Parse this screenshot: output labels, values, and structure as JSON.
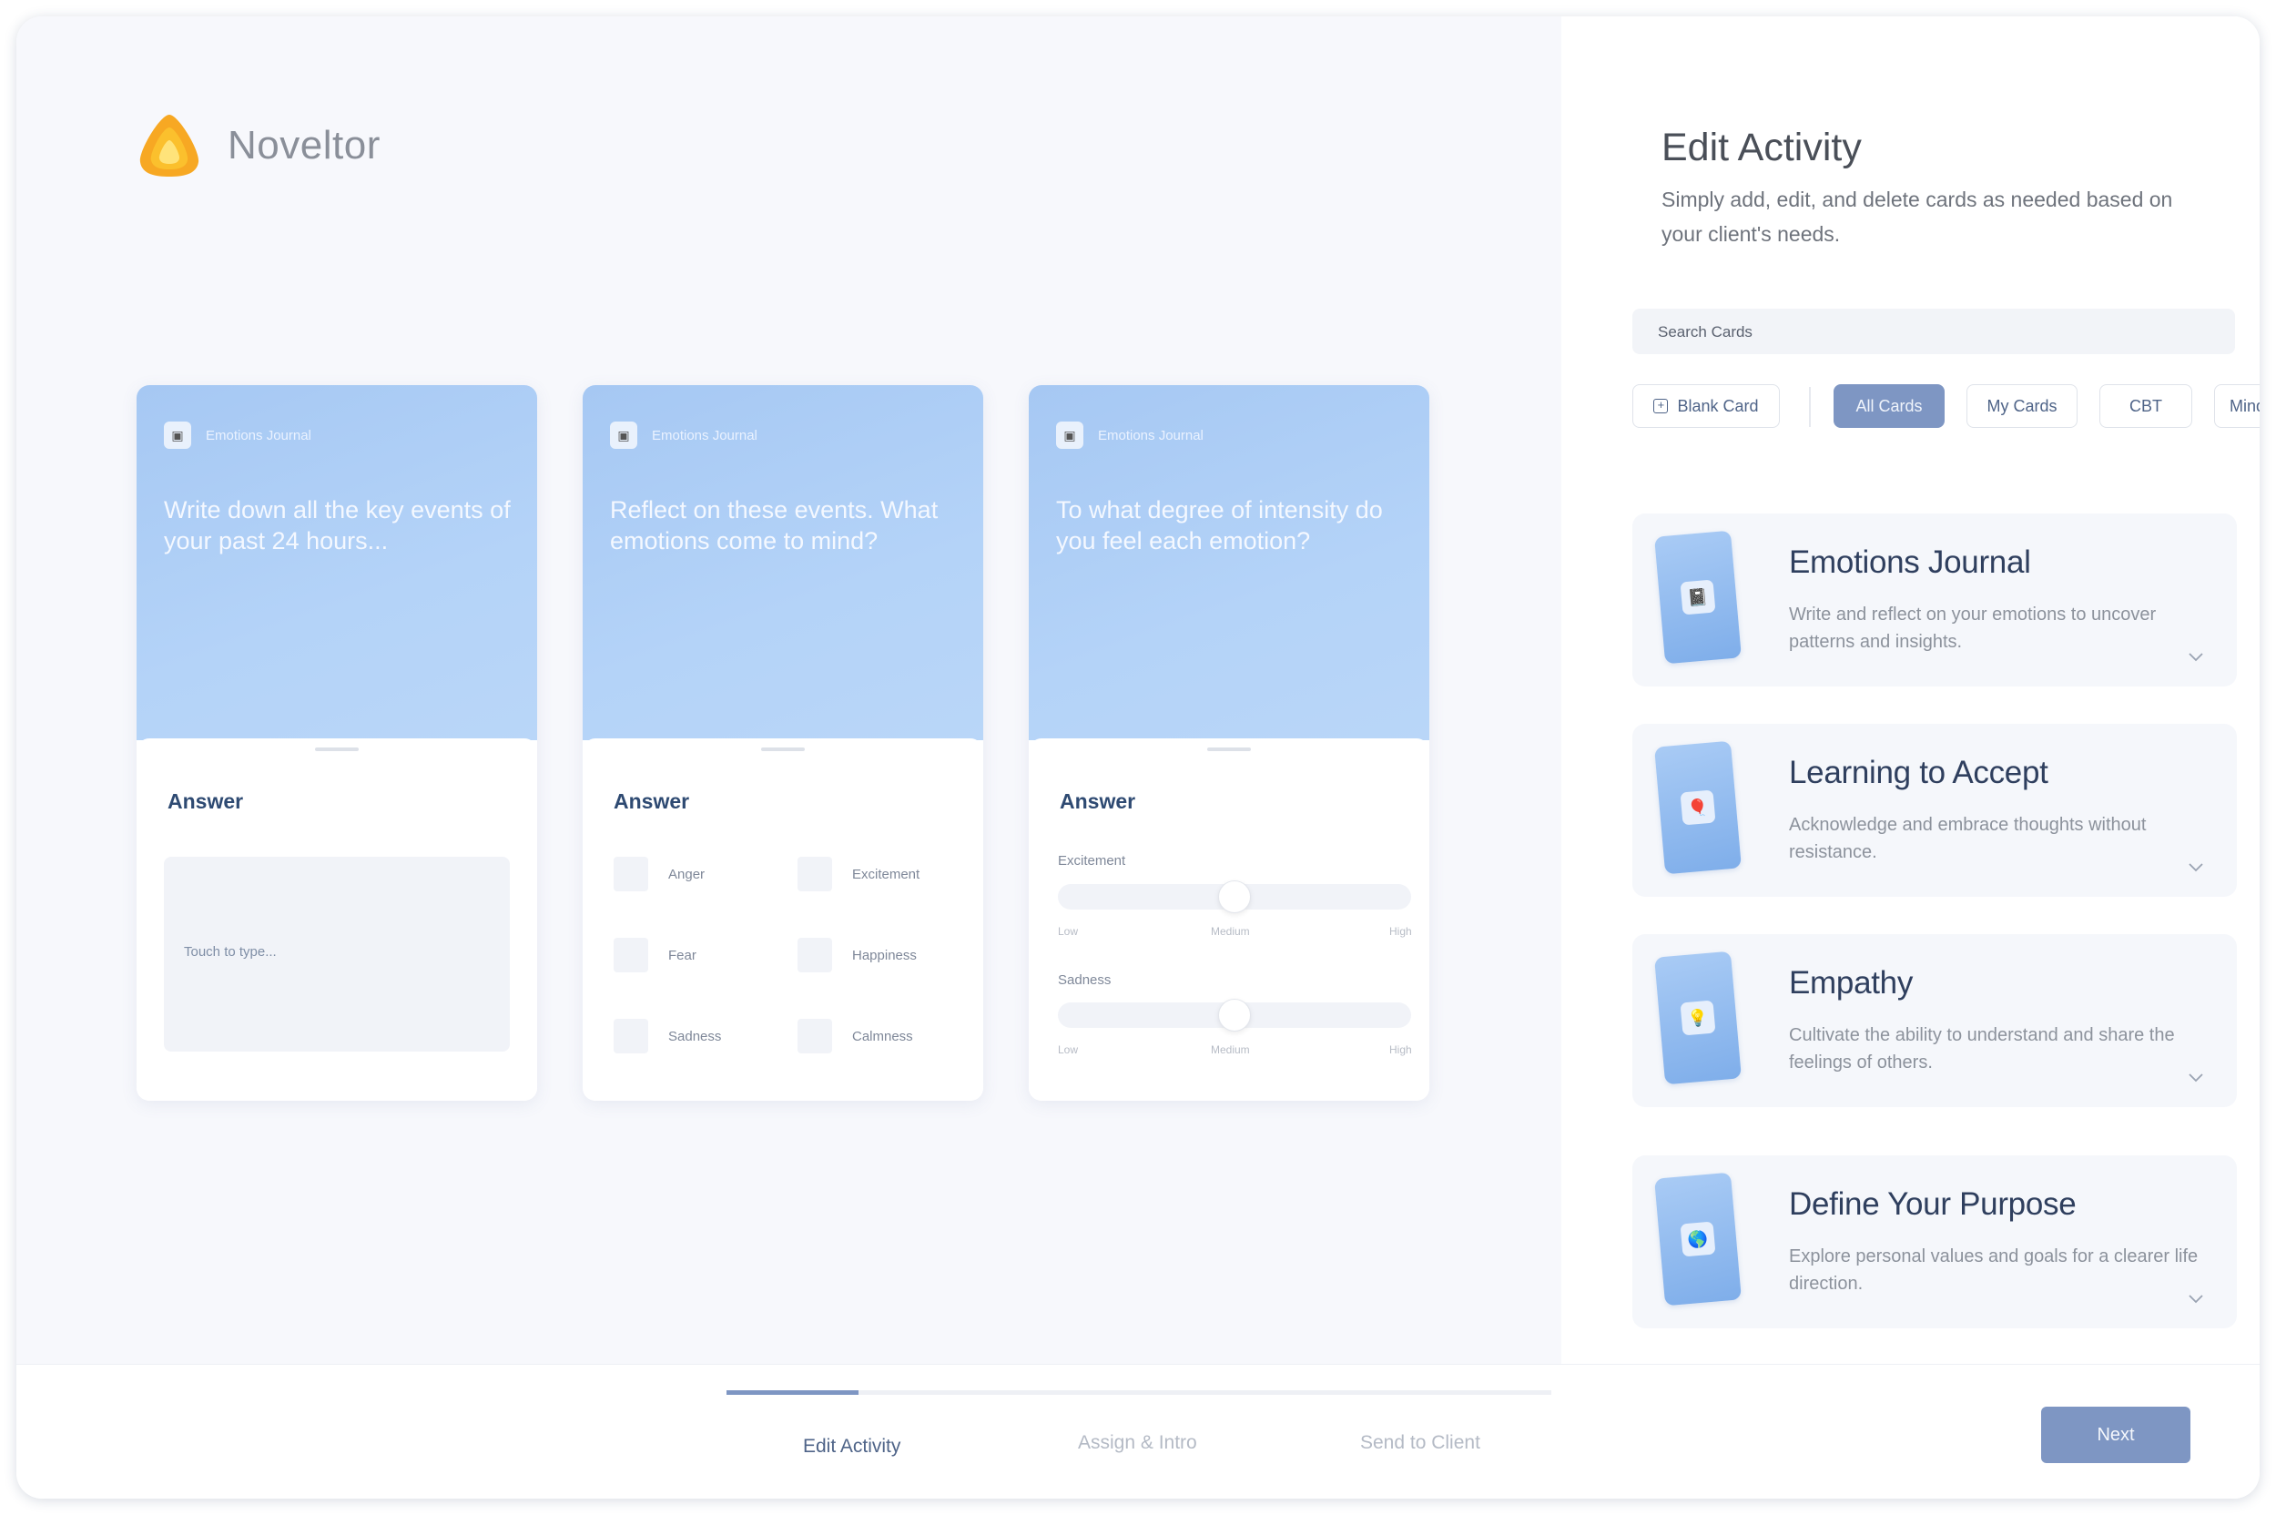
{
  "app": {
    "name": "Noveltor"
  },
  "preview_cards": [
    {
      "chip": "Emotions Journal",
      "question": "Write down all the key events of your past 24 hours...",
      "answer_label": "Answer",
      "type": "text",
      "placeholder": "Touch to type..."
    },
    {
      "chip": "Emotions Journal",
      "question": "Reflect on these events. What emotions come to mind?",
      "answer_label": "Answer",
      "type": "checkbox",
      "options": [
        "Anger",
        "Excitement",
        "Fear",
        "Happiness",
        "Sadness",
        "Calmness"
      ]
    },
    {
      "chip": "Emotions Journal",
      "question": "To what degree of intensity do you feel each emotion?",
      "answer_label": "Answer",
      "type": "slider",
      "sliders": [
        {
          "label": "Excitement",
          "value": 0.5,
          "low": "Low",
          "mid": "Medium",
          "high": "High"
        },
        {
          "label": "Sadness",
          "value": 0.5,
          "low": "Low",
          "mid": "Medium",
          "high": "High"
        }
      ]
    }
  ],
  "panel": {
    "title": "Edit Activity",
    "subtitle": "Simply add, edit, and delete cards as needed based on your client's needs.",
    "search_placeholder": "Search Cards",
    "blank_card": "Blank Card",
    "filters": [
      "All Cards",
      "My Cards",
      "CBT",
      "Mindful"
    ],
    "active_filter": "All Cards",
    "activities": [
      {
        "title": "Emotions Journal",
        "desc": "Write and reflect on your emotions to uncover patterns and insights.",
        "icon": "notebook-icon",
        "glyph": "📓"
      },
      {
        "title": "Learning to Accept",
        "desc": "Acknowledge and embrace thoughts without resistance.",
        "icon": "balloon-icon",
        "glyph": "🎈"
      },
      {
        "title": "Empathy",
        "desc": "Cultivate the ability to understand and share the feelings of others.",
        "icon": "lightbulb-icon",
        "glyph": "💡"
      },
      {
        "title": "Define Your Purpose",
        "desc": "Explore personal values and goals for a clearer life direction.",
        "icon": "globe-icon",
        "glyph": "🌎"
      }
    ]
  },
  "footer": {
    "steps": [
      "Edit Activity",
      "Assign & Intro",
      "Send to Client"
    ],
    "current_step": 1,
    "total_steps": 3,
    "progress": 0.16,
    "next_label": "Next"
  },
  "colors": {
    "accent": "#7e96c3",
    "card_blue": "#a6c8f3",
    "logo": "#f7a823"
  }
}
